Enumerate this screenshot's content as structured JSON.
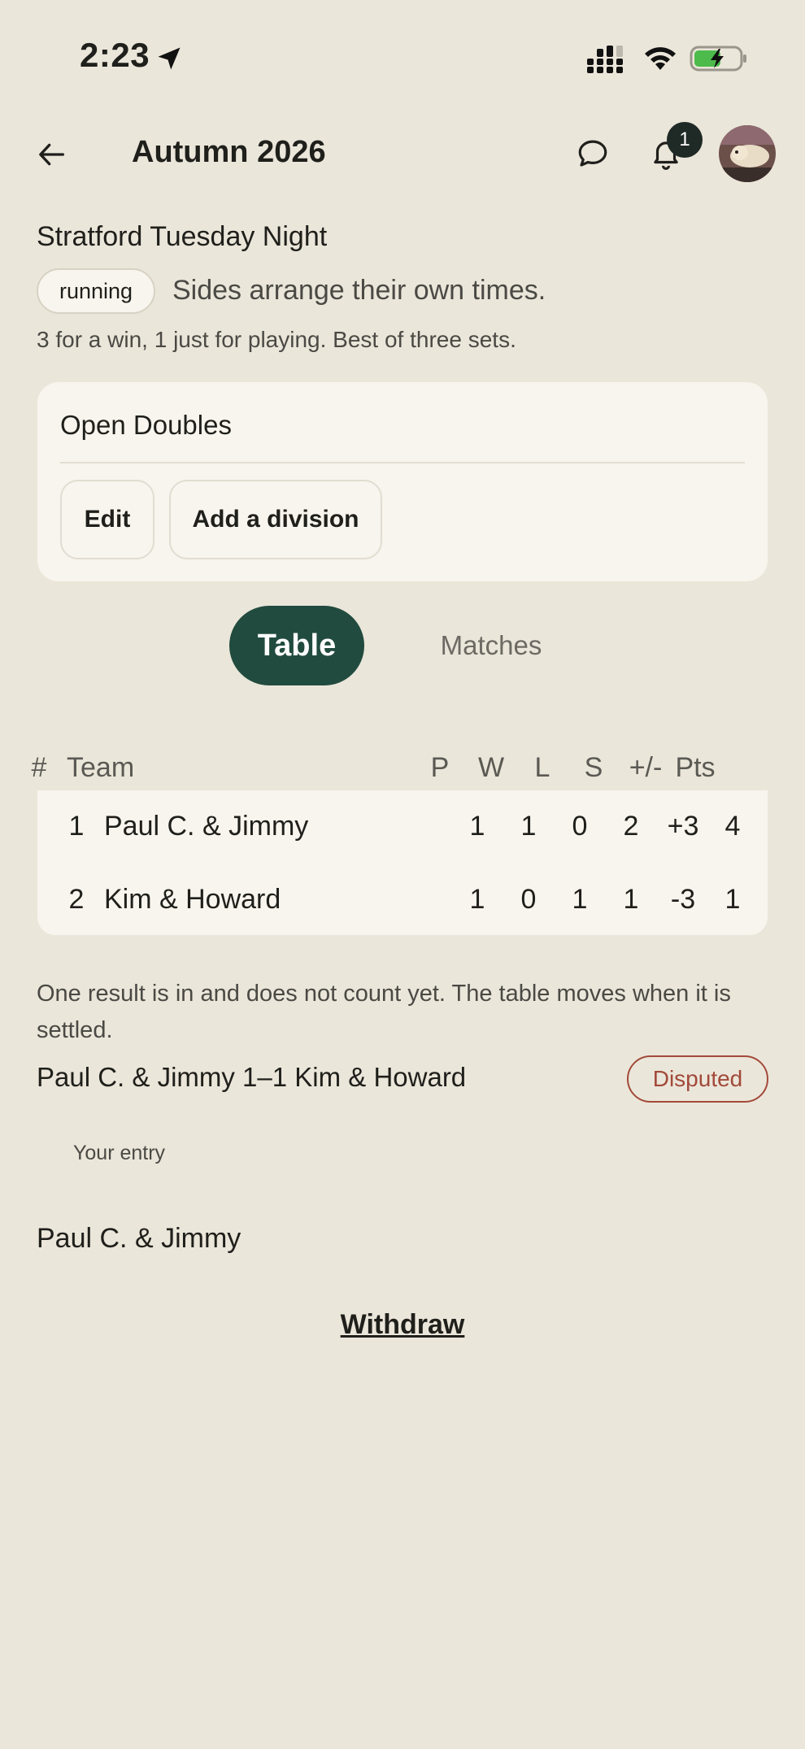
{
  "status_bar": {
    "time": "2:23",
    "icons": [
      "location-arrow-icon",
      "cellular-signal-icon",
      "wifi-icon",
      "battery-charging-icon"
    ]
  },
  "header": {
    "title": "Autumn 2026",
    "notification_count": "1",
    "icons": [
      "back-arrow-icon",
      "chat-bubble-icon",
      "bell-icon"
    ]
  },
  "league": {
    "name": "Stratford Tuesday Night",
    "status": "running",
    "schedule": "Sides arrange their own times.",
    "rules": "3 for a win, 1 just for playing. Best of three sets."
  },
  "division": {
    "title": "Open Doubles",
    "edit_label": "Edit",
    "add_label": "Add a division"
  },
  "tabs": {
    "table": "Table",
    "matches": "Matches",
    "active": "Table",
    "active_color": "#214b3e"
  },
  "standings": {
    "columns": {
      "rank": "#",
      "team": "Team",
      "played": "P",
      "won": "W",
      "lost": "L",
      "sets": "S",
      "diff": "+/-",
      "points": "Pts"
    },
    "rows": [
      {
        "rank": "1",
        "team": "Paul C. & Jimmy",
        "played": "1",
        "won": "1",
        "lost": "0",
        "sets": "2",
        "diff": "+3",
        "points": "4"
      },
      {
        "rank": "2",
        "team": "Kim & Howard",
        "played": "1",
        "won": "0",
        "lost": "1",
        "sets": "1",
        "diff": "-3",
        "points": "1"
      }
    ]
  },
  "pending": {
    "note": "One result is in and does not count yet. The table moves when it is settled.",
    "match": "Paul C. & Jimmy 1–1 Kim & Howard",
    "status": "Disputed",
    "status_color": "#a24a3a"
  },
  "entry": {
    "label": "Your entry",
    "team": "Paul C. & Jimmy",
    "withdraw_label": "Withdraw"
  },
  "colors": {
    "background": "#ebe6da",
    "card": "#f8f5ee",
    "accent": "#214b3e"
  }
}
